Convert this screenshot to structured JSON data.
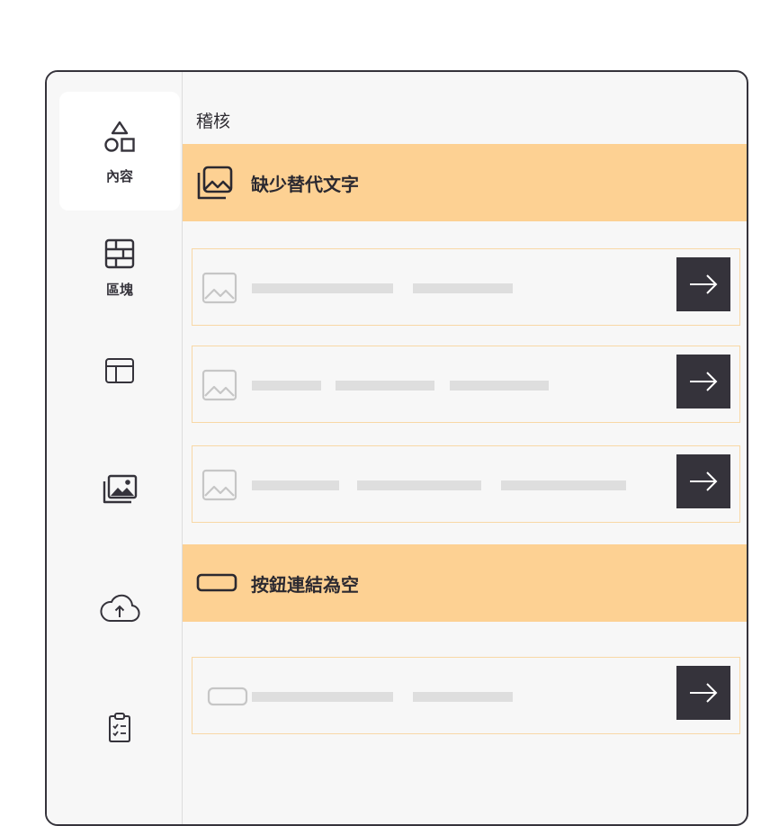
{
  "sidebar": {
    "items": [
      {
        "name": "content",
        "label": "內容",
        "icon": "shapes-icon",
        "active": true
      },
      {
        "name": "blocks",
        "label": "區塊",
        "icon": "block-grid-icon",
        "active": false
      },
      {
        "name": "layout",
        "icon": "layout-icon",
        "active": false
      },
      {
        "name": "media",
        "icon": "images-icon",
        "active": false
      },
      {
        "name": "upload",
        "icon": "cloud-upload-icon",
        "active": false
      },
      {
        "name": "audit",
        "icon": "clipboard-check-icon",
        "active": false
      }
    ]
  },
  "panel": {
    "title": "稽核",
    "sections": [
      {
        "title": "缺少替代文字",
        "icon": "image-icon",
        "rows": 3
      },
      {
        "title": "按鈕連結為空",
        "icon": "button-icon",
        "rows": 1
      }
    ]
  },
  "colors": {
    "accent": "#fdd193",
    "dark": "#35333b",
    "row_border": "#f8d8a6",
    "placeholder": "#dedede"
  }
}
